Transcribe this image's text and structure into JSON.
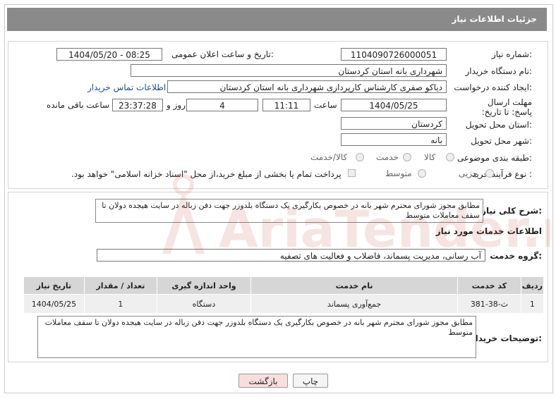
{
  "header": {
    "title": "جزئیات اطلاعات نیاز"
  },
  "form": {
    "need_number_label": "شماره نیاز:",
    "need_number": "1104090726000051",
    "announce_label": "تاریخ و ساعت اعلان عمومی:",
    "announce_value": "1404/05/20 - 08:25",
    "buyer_org_label": "نام دستگاه خریدار:",
    "buyer_org": "شهرداری بانه استان کردستان",
    "requester_label": "ایجاد کننده درخواست:",
    "requester": "دیاکو صفری کارشناس کارپردازی شهرداری بانه استان کردستان",
    "contact_link": "اطلاعات تماس خریدار",
    "deadline_label": "مهلت ارسال پاسخ: تا تاریخ:",
    "deadline_date": "1404/05/25",
    "time_label": "ساعت",
    "deadline_time": "11:11",
    "days_value": "4",
    "days_label": "روز و",
    "remaining_time": "23:37:28",
    "remaining_label": "ساعت باقی مانده",
    "province_label": "استان محل تحویل:",
    "province": "کردستان",
    "city_label": "شهر محل تحویل:",
    "city": "بانه",
    "category_label": "طبقه بندی موضوعی:",
    "category_options": [
      "کالا",
      "خدمت",
      "کالا/خدمت"
    ],
    "process_label": "نوع فرآیند خرید :",
    "process_options": [
      "جزیی",
      "متوسط"
    ],
    "payment_note": "پرداخت تمام یا بخشی از مبلغ خرید،از محل \"اسناد خزانه اسلامی\" خواهد بود."
  },
  "details": {
    "summary_label": "شرح کلی نیاز:",
    "summary": "مطابق مجوز شورای محترم شهر بانه در خصوص بکارگیری یک دستگاه بلدوزر جهت دفن زباله در سایت هیجده دولان تا سقف معاملات متوسط",
    "services_heading": "اطلاعات خدمات مورد نیاز",
    "service_group_label": "گروه خدمت:",
    "service_group": "آب رسانی، مدیریت پسماند، فاضلاب و فعالیت های تصفیه",
    "table": {
      "headers": [
        "ردیف",
        "کد خدمت",
        "نام خدمت",
        "واحد اندازه گیری",
        "تعداد / مقدار",
        "تاریخ نیاز"
      ],
      "rows": [
        [
          "1",
          "ث-38-381",
          "جمع‌آوری پسماند",
          "دستگاه",
          "1",
          "1404/05/25"
        ]
      ]
    },
    "buyer_notes_label": "توضیحات خریدار:",
    "buyer_notes": "مطابق مجوز شورای محترم شهر بانه در خصوص بکارگیری یک دستگاه بلدوزر جهت دفن زباله در سایت هیجده دولان تا سقف معاملات متوسط"
  },
  "buttons": {
    "print": "چاپ",
    "back": "بازگشت"
  },
  "watermark": {
    "text": "AriaTender.neT"
  },
  "colors": {
    "header_bg": "#8a8a8a",
    "link": "#1a4fa0",
    "back_btn_bg": "#f9dede",
    "watermark": "#c0392b"
  }
}
